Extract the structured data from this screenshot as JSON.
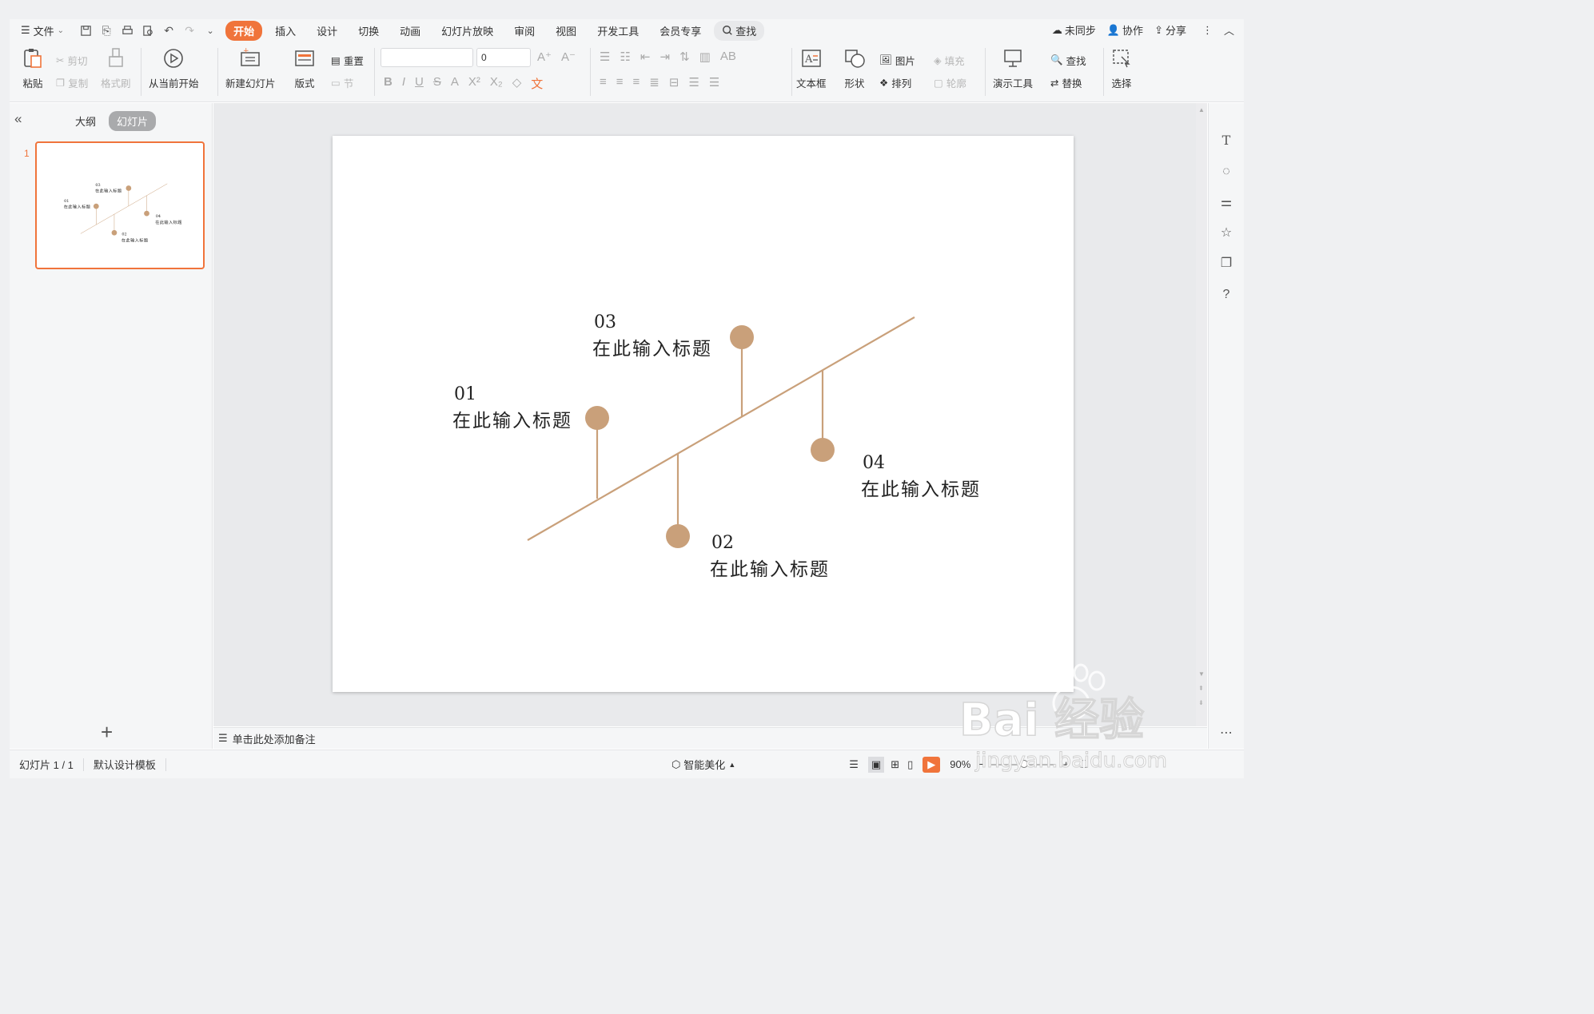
{
  "menu": {
    "file_label": "文件",
    "tabs": [
      "开始",
      "插入",
      "设计",
      "切换",
      "动画",
      "幻灯片放映",
      "审阅",
      "视图",
      "开发工具",
      "会员专享"
    ],
    "search_label": "查找",
    "right": {
      "sync": "未同步",
      "collab": "协作",
      "share": "分享"
    }
  },
  "ribbon": {
    "paste": "粘贴",
    "cut": "剪切",
    "copy": "复制",
    "format_painter": "格式刷",
    "from_current": "从当前开始",
    "new_slide": "新建幻灯片",
    "layout": "版式",
    "reset": "重置",
    "section": "节",
    "font_size": "0",
    "textbox": "文本框",
    "shape": "形状",
    "picture": "图片",
    "fill": "填充",
    "arrange": "排列",
    "outline": "轮廓",
    "present_tools": "演示工具",
    "find": "查找",
    "replace": "替换",
    "select": "选择"
  },
  "left_panel": {
    "outline_tab": "大纲",
    "slides_tab": "幻灯片",
    "slide_number": "1"
  },
  "slide": {
    "items": [
      {
        "num": "01",
        "title": "在此输入标题"
      },
      {
        "num": "02",
        "title": "在此输入标题"
      },
      {
        "num": "03",
        "title": "在此输入标题"
      },
      {
        "num": "04",
        "title": "在此输入标题"
      }
    ],
    "accent_color": "#c9a07a"
  },
  "notes": {
    "placeholder": "单击此处添加备注"
  },
  "status": {
    "slide_count": "幻灯片 1 / 1",
    "template": "默认设计模板",
    "beautify": "智能美化",
    "zoom": "90%"
  },
  "watermark": {
    "brand": "Bai 经验",
    "url": "jingyan.baidu.com"
  }
}
